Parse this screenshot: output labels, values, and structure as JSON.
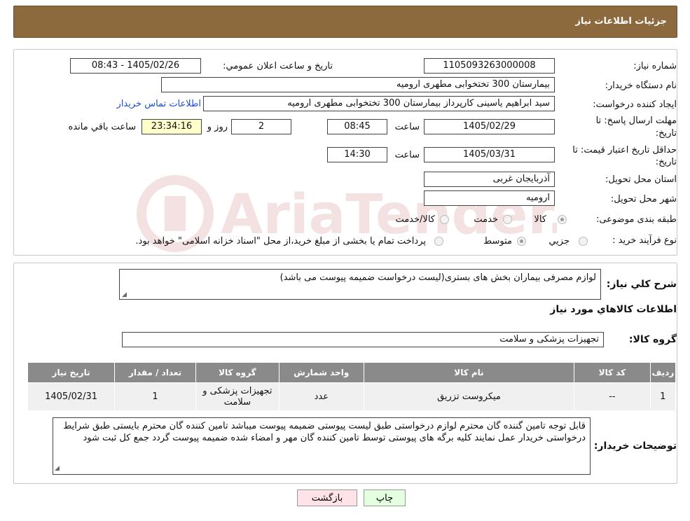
{
  "header": {
    "title": "جزئیات اطلاعات نیاز"
  },
  "form": {
    "need_number_label": "شماره نیاز:",
    "need_number": "1105093263000008",
    "announce_label": "تاريخ و ساعت اعلان عمومي:",
    "announce_value": "1405/02/26 - 08:43",
    "buyer_org_label": "نام دستگاه خريدار:",
    "buyer_org": "بیمارستان 300 تختخوابی مطهری  ارومیه",
    "requester_label": "ايجاد کننده درخواست:",
    "requester": "سید ابراهیم یاسینی کارپرداز بیمارستان 300 تختخوابی مطهری  ارومیه",
    "contact_link": "اطلاعات تماس خريدار",
    "reply_deadline_label_1": "مهلت ارسال پاسخ: تا",
    "reply_deadline_label_2": "تاريخ:",
    "reply_date": "1405/02/29",
    "time_label": "ساعت",
    "reply_time": "08:45",
    "days_value": "2",
    "days_label": "روز و",
    "remaining_time": "23:34:16",
    "remaining_label": "ساعت باقي مانده",
    "validity_label_1": "حداقل تاريخ اعتبار قيمت: تا",
    "validity_label_2": "تاريخ:",
    "validity_date": "1405/03/31",
    "validity_time": "14:30",
    "province_label": "استان محل تحويل:",
    "province": "آذربایجان غربی",
    "city_label": "شهر محل تحويل:",
    "city": "ارومیه",
    "category_label": "طبقه بندی موضوعی:",
    "category_options": [
      "کالا",
      "خدمت",
      "کالا/خدمت"
    ],
    "process_label": "نوع فرآيند خريد :",
    "process_options": [
      "جزيي",
      "متوسط"
    ],
    "process_note": "پرداخت تمام یا بخشی از مبلغ خرید،از محل \"اسناد خزانه اسلامی\" خواهد بود."
  },
  "details": {
    "summary_label": "شرح کلي نياز:",
    "summary": "لوازم مصرفی بیماران بخش های بستری(لیست درخواست ضمیمه پیوست می باشد)",
    "goods_info_title": "اطلاعات کالاهاي مورد نياز",
    "goods_group_label": "گروه کالا:",
    "goods_group": "تجهیزات پزشکی و سلامت",
    "table": {
      "headers": [
        "رديف",
        "کد کالا",
        "نام کالا",
        "واحد شمارش",
        "گروه کالا",
        "تعداد / مقدار",
        "تاريخ نياز"
      ],
      "rows": [
        [
          "1",
          "--",
          "میکروست تزریق",
          "عدد",
          "تجهیزات پزشکی و سلامت",
          "1",
          "1405/02/31"
        ]
      ]
    },
    "buyer_notes_label": "توضيحات خريدار:",
    "buyer_notes": "قابل توجه تامین گننده گان محترم لوازم درخواستی طبق لیست پیوستی ضمیمه پیوست میباشد تامین کننده گان محترم بایستی طبق شرایط درخواستی خریدار عمل نمایند کلیه برگه های پیوستی توسط تامین کننده گان مهر و امضاء شده ضمیمه پیوست گردد جمع کل ثبت شود"
  },
  "buttons": {
    "print": "چاپ",
    "back": "بازگشت"
  },
  "watermark": {
    "brand": "AriaTender.neT"
  }
}
